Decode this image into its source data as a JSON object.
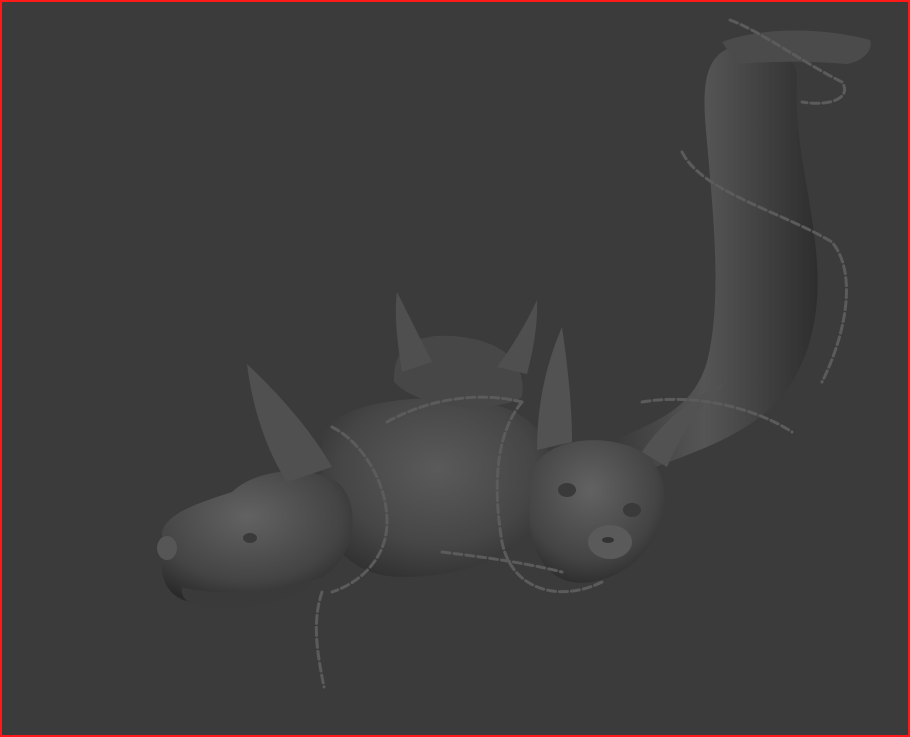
{
  "viewport": {
    "border_color": "#ff1a1a",
    "background_color": "#3b3b3b"
  },
  "model": {
    "icon": "three-headed-chained-dog-sculpt",
    "base_color": "#4a4a4a"
  }
}
